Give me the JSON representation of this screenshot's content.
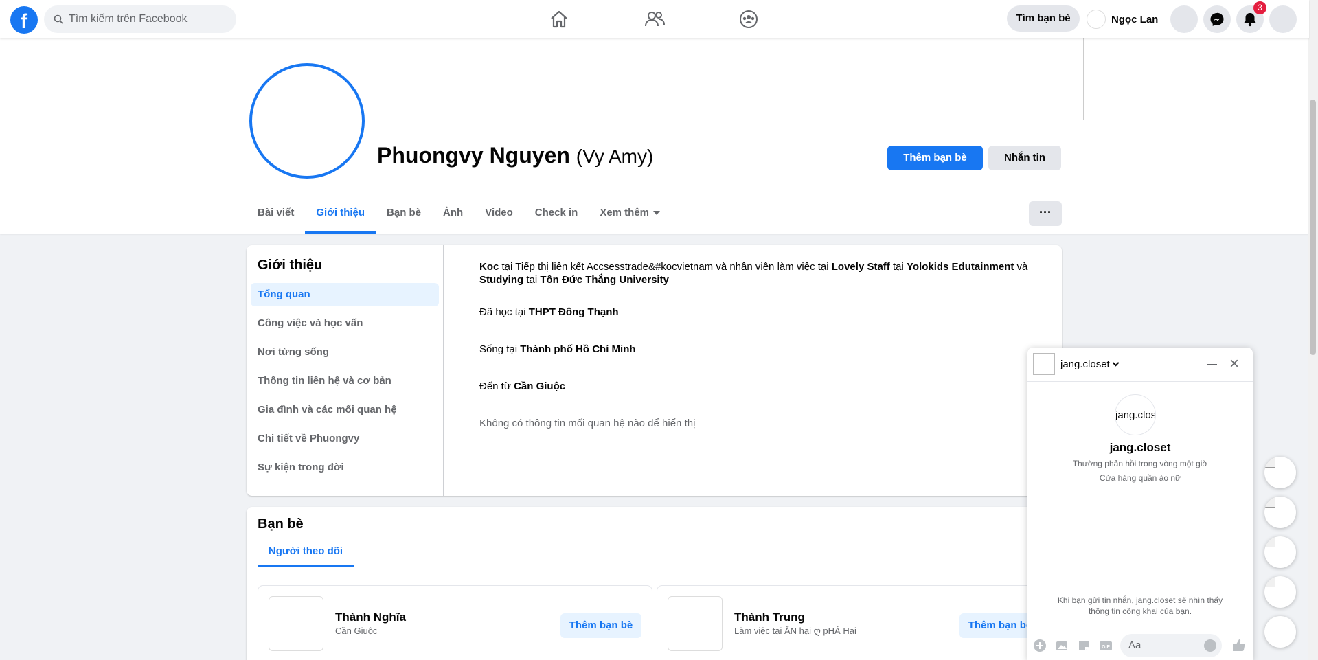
{
  "topbar": {
    "logo": "f",
    "search_placeholder": "Tìm kiếm trên Facebook",
    "find_friends": "Tìm bạn bè",
    "user_name": "Ngọc Lan",
    "notification_count": "3"
  },
  "profile": {
    "name": "Phuongvy Nguyen",
    "alt_name": "(Vy Amy)",
    "add_friend": "Thêm bạn bè",
    "message": "Nhắn tin",
    "more": "···",
    "tabs": [
      "Bài viết",
      "Giới thiệu",
      "Bạn bè",
      "Ảnh",
      "Video",
      "Check in",
      "Xem thêm"
    ]
  },
  "about": {
    "title": "Giới thiệu",
    "nav": [
      "Tổng quan",
      "Công việc và học vấn",
      "Nơi từng sống",
      "Thông tin liên hệ và cơ bản",
      "Gia đình và các mối quan hệ",
      "Chi tiết về Phuongvy",
      "Sự kiện trong đời"
    ],
    "work": {
      "role1": "Koc",
      "t1": " tại Tiếp thị liên kết Accsesstrade&#kocvietnam và nhân viên làm việc tại ",
      "org1": "Lovely Staff",
      "t2": " tại ",
      "org2": "Yolokids Edutainment",
      "t3": " và ",
      "role2": "Studying",
      "t4": " tại ",
      "org3": "Tôn Đức Thắng University"
    },
    "studied_prefix": "Đã học tại ",
    "studied": "THPT Đông Thạnh",
    "lives_prefix": "Sống tại ",
    "lives": "Thành phố Hồ Chí Minh",
    "from_prefix": "Đến từ ",
    "from": "Cần Giuộc",
    "relationship": "Không có thông tin mối quan hệ nào để hiển thị"
  },
  "friends": {
    "title": "Bạn bè",
    "tab": "Người theo dõi",
    "cards": [
      {
        "name": "Thành Nghĩa",
        "sub": "Cần Giuộc",
        "button": "Thêm bạn bè"
      },
      {
        "name": "Thành Trung",
        "sub": "Làm việc tại ĂN hại ღ pHÁ Hại",
        "button": "Thêm bạn bè"
      }
    ]
  },
  "chat": {
    "name": "jang.closet",
    "avatar_alt": "jang.clos",
    "response": "Thường phản hồi trong vòng một giờ",
    "category": "Cửa hàng quần áo nữ",
    "notice": "Khi bạn gửi tin nhắn, jang.closet sẽ nhìn thấy thông tin công khai của bạn.",
    "input_placeholder": "Aa",
    "close": "×"
  },
  "colors": {
    "accent": "#1877f2",
    "badge": "#e41e3f"
  }
}
